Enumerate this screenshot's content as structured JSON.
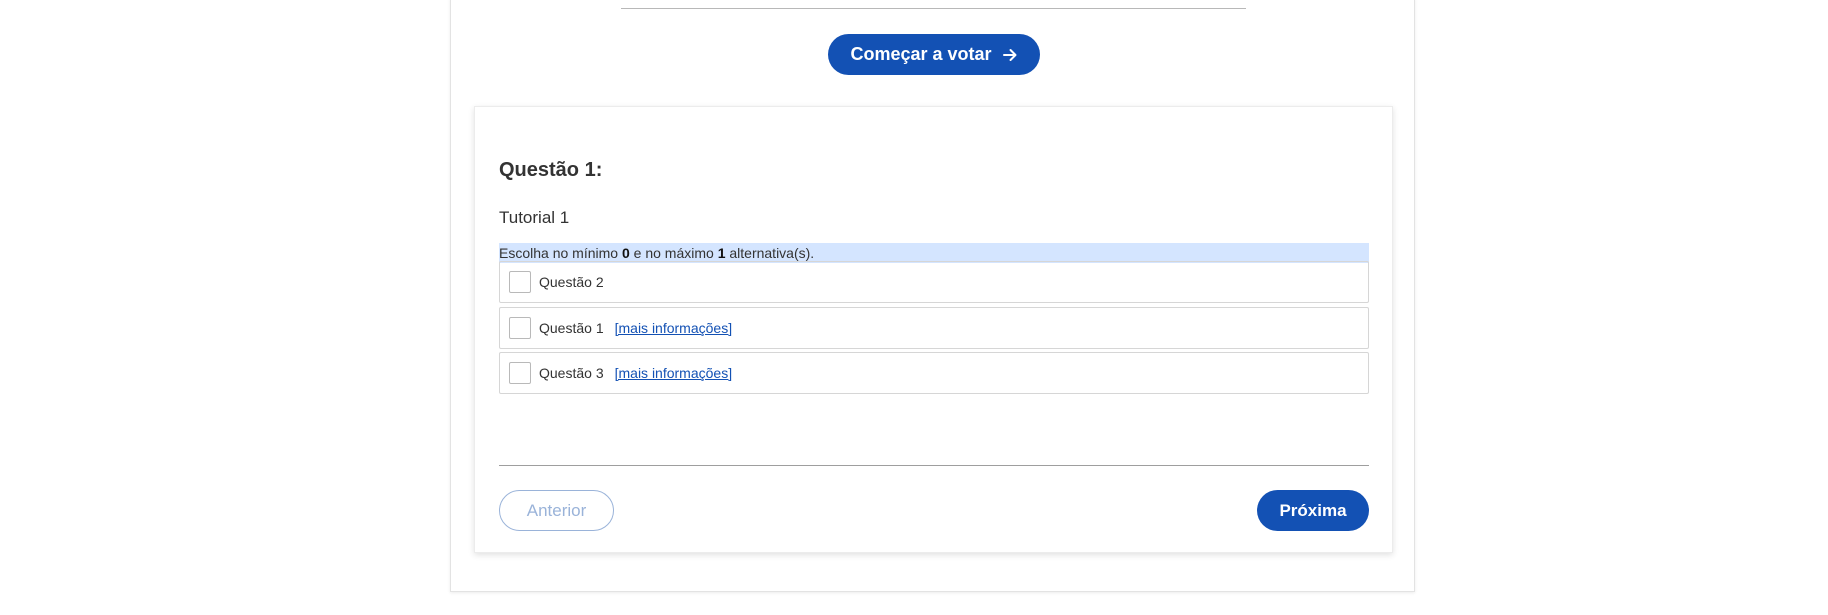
{
  "header": {
    "start_button_label": "Começar a votar"
  },
  "question": {
    "title": "Questão 1:",
    "subtitle": "Tutorial 1",
    "instruction": {
      "prefix": "Escolha no mínimo ",
      "min": "0",
      "middle": " e no máximo ",
      "max": "1",
      "suffix": " alternativa(s)."
    },
    "options": [
      {
        "label": "Questão 2",
        "more_info": ""
      },
      {
        "label": "Questão 1",
        "more_info": "[mais informações]"
      },
      {
        "label": "Questão 3",
        "more_info": "[mais informações]"
      }
    ]
  },
  "navigation": {
    "prev_label": "Anterior",
    "next_label": "Próxima"
  },
  "icons": {
    "start_button_icon": "arrow-right-icon"
  },
  "colors": {
    "primary": "#1351b4",
    "instruction_bg": "#d4e5ff",
    "disabled": "#9ab3d9"
  }
}
